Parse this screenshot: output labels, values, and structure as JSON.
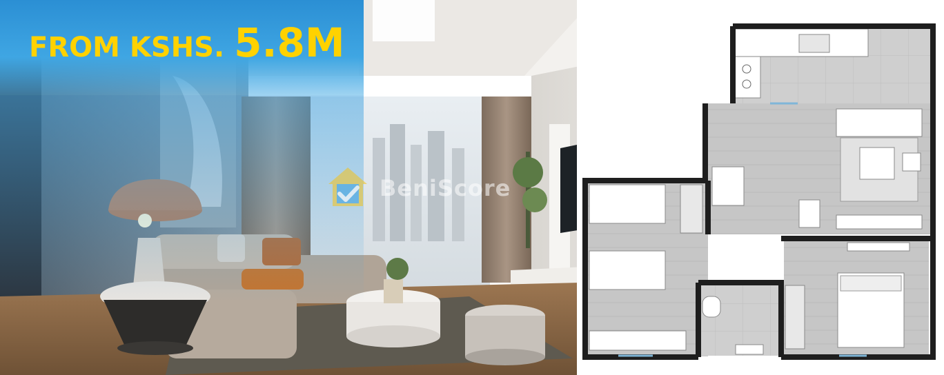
{
  "banner": {
    "price_prefix": "FROM KSHS.",
    "price_amount": "5.8M",
    "text_color": "#ffd200",
    "background_color": "#2f95d8"
  },
  "watermark": {
    "brand": "BeniScore",
    "logo_icon": "house-check-icon"
  },
  "colors": {
    "floor_wood": "#b08a63",
    "walls": "#e9e6e1",
    "floorplan_tile": "#c9c9c9",
    "floorplan_walls": "#1e1e1e"
  }
}
